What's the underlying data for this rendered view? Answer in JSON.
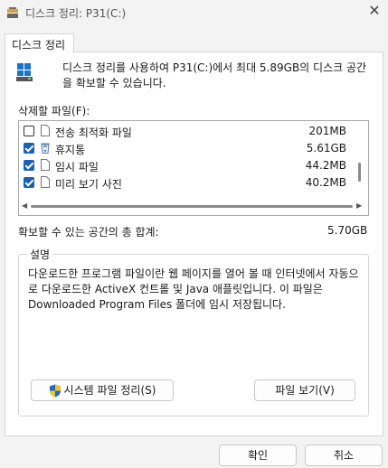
{
  "window": {
    "title": "디스크 정리: P31(C:)"
  },
  "tabs": [
    {
      "label": "디스크 정리"
    }
  ],
  "header": {
    "text": "디스크 정리를 사용하여 P31(C:)에서 최대 5.89GB의 디스크 공간을 확보할 수 있습니다."
  },
  "files_label": "삭제할 파일(F):",
  "files": [
    {
      "name": "전송 최적화 파일",
      "size": "201MB",
      "checked": false,
      "icon": "file-icon"
    },
    {
      "name": "휴지통",
      "size": "5.61GB",
      "checked": true,
      "icon": "recycle-bin-icon"
    },
    {
      "name": "임시 파일",
      "size": "44.2MB",
      "checked": true,
      "icon": "file-icon"
    },
    {
      "name": "미리 보기 사진",
      "size": "40.2MB",
      "checked": true,
      "icon": "file-icon"
    }
  ],
  "total": {
    "label": "확보할 수 있는 공간의 총 합계:",
    "value": "5.70GB"
  },
  "description": {
    "title": "설명",
    "text": "다운로드한 프로그램 파일이란 웹 페이지를 열어 볼 때 인터넷에서 자동으로 다운로드한 ActiveX 컨트롤 및 Java 애플릿입니다. 이 파일은 Downloaded Program Files 폴더에 임시 저장됩니다."
  },
  "buttons": {
    "cleanup_system": "시스템 파일 정리(S)",
    "view_files": "파일 보기(V)",
    "ok": "확인",
    "cancel": "취소"
  },
  "colors": {
    "accent": "#1a5fb4"
  }
}
